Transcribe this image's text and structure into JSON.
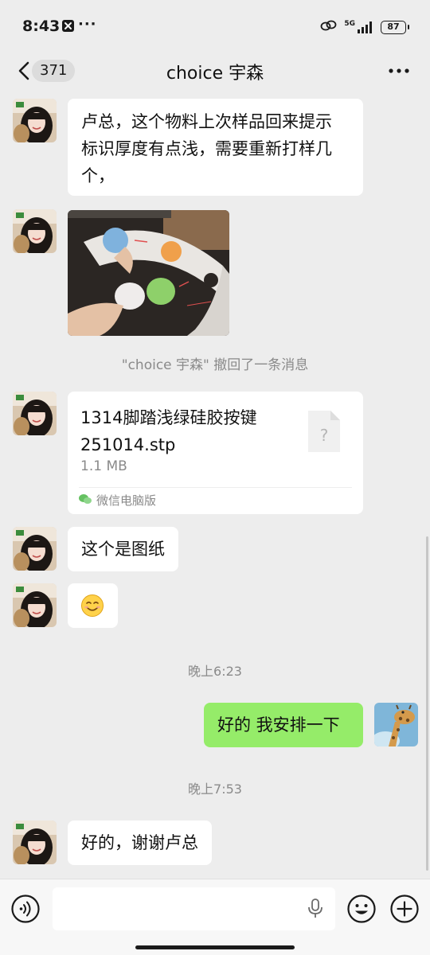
{
  "status_bar": {
    "time": "8:43",
    "notification_dots": "···",
    "network_label": "5G",
    "battery": "87",
    "icons": [
      "x-app-icon",
      "link-icon",
      "signal-icon",
      "battery-icon"
    ]
  },
  "header": {
    "unread_count": "371",
    "title": "choice 宇森",
    "icons": [
      "back-arrow-icon",
      "more-dots-icon"
    ]
  },
  "messages": [
    {
      "type": "text",
      "side": "left",
      "text": "卢总，这个物料上次样品回来提示标识厚度有点浅，需要重新打样几个，",
      "lines": [
        "卢总，这个物料上次样品回来提示",
        "标识厚度有点浅，需要重新打样几",
        "个，"
      ]
    },
    {
      "type": "image",
      "side": "left",
      "description_icon": "photo-icon"
    },
    {
      "type": "system",
      "text": "\"choice 宇森\" 撤回了一条消息"
    },
    {
      "type": "file",
      "side": "left",
      "file_name": "1314脚踏浅绿硅胶按键251014.stp",
      "file_name_lines": [
        "1314脚踏浅绿硅胶按键",
        "251014.stp"
      ],
      "file_size": "1.1 MB",
      "source": "微信电脑版"
    },
    {
      "type": "text",
      "side": "left",
      "text": "这个是图纸"
    },
    {
      "type": "emoji",
      "side": "left",
      "text": "😊"
    },
    {
      "type": "time",
      "text": "晚上6:23"
    },
    {
      "type": "text",
      "side": "right",
      "text": "好的 我安排一下"
    },
    {
      "type": "time",
      "text": "晚上7:53"
    },
    {
      "type": "text",
      "side": "left",
      "text": "好的，谢谢卢总"
    }
  ],
  "input_bar": {
    "icons": [
      "voice-icon",
      "mic-icon",
      "emoji-icon",
      "plus-icon"
    ]
  },
  "colors": {
    "background": "#ededed",
    "my_bubble": "#95ec69",
    "their_bubble": "#ffffff",
    "muted_text": "#8a8a8a"
  }
}
